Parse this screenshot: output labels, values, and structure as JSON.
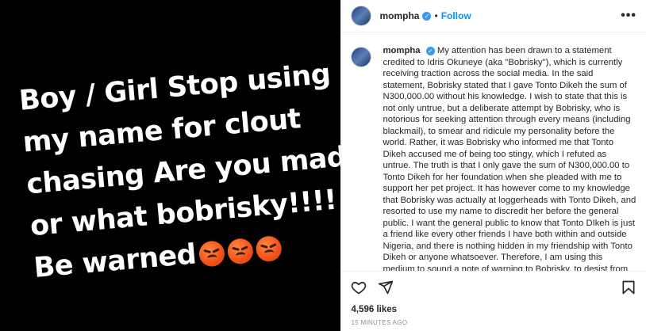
{
  "post": {
    "media": {
      "lines": [
        "Boy / Girl Stop using",
        "my name for clout",
        "chasing Are you mad",
        "or what bobrisky!!!!",
        "Be warned"
      ],
      "emoji_icons": [
        "angry-face-icon",
        "angry-face-icon",
        "angry-face-icon"
      ]
    },
    "header": {
      "username": "mompha",
      "separator": "•",
      "follow_label": "Follow",
      "more_label": "•••"
    },
    "caption": {
      "username": "mompha",
      "text": "My attention has been drawn to a statement credited to Idris Okuneye (aka \"Bobrisky\"), which is currently receiving traction across the social media. In the said statement, Bobrisky stated that I gave Tonto Dikeh the sum of N300,000.00 without his knowledge. I wish to state that this is not only untrue, but a deliberate attempt by Bobrisky, who is notorious for seeking attention through every means (including blackmail), to smear and ridicule my personality before the world. Rather, it was Bobrisky who informed me that Tonto Dikeh accused me of being too stingy, which I refuted as untrue. The truth is that I only gave the sum of N300,000.00 to Tonto Dikeh for her foundation when she pleaded with me to support her pet project. It has however come to my knowledge that Bobrisky was actually at loggerheads with Tonto Dikeh, and resorted to use my name to discredit her before the general public. I want the general public to know that Tonto DIkeh is just a friend like every other friends I have both within and outside Nigeria, and there is nothing hidden in my friendship with Tonto Dikeh or anyone whatsoever. Therefore, I am using this medium to sound a note of warning to Bobrisky, to desist from mentioning my name in any fight he might have with Tonto Dikeh"
    },
    "likes": "4,596 likes",
    "time": "15 MINUTES AGO",
    "colors": {
      "accent": "#0095f6",
      "verified": "#3897f0"
    }
  }
}
